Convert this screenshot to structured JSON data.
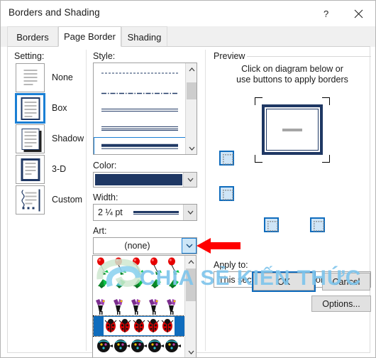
{
  "window": {
    "title": "Borders and Shading",
    "help_icon": "question-mark-icon",
    "close_icon": "close-icon"
  },
  "tabs": [
    {
      "id": "borders",
      "label": "Borders",
      "active": false
    },
    {
      "id": "page-border",
      "label": "Page Border",
      "active": true
    },
    {
      "id": "shading",
      "label": "Shading",
      "active": false
    }
  ],
  "setting": {
    "label": "Setting:",
    "options": [
      {
        "id": "none",
        "label": "None",
        "selected": false
      },
      {
        "id": "box",
        "label": "Box",
        "selected": true
      },
      {
        "id": "shadow",
        "label": "Shadow",
        "selected": false
      },
      {
        "id": "3-d",
        "label": "3-D",
        "selected": false
      },
      {
        "id": "custom",
        "label": "Custom",
        "selected": false
      }
    ]
  },
  "style": {
    "label": "Style:",
    "items": [
      {
        "id": "dashed",
        "selected": false
      },
      {
        "id": "dash-dot",
        "selected": false
      },
      {
        "id": "double-line",
        "selected": false
      },
      {
        "id": "triple-line",
        "selected": false
      },
      {
        "id": "thick-line",
        "selected": true
      }
    ],
    "scroll_up_icon": "chevron-up-icon",
    "scroll_down_icon": "chevron-down-icon"
  },
  "color": {
    "label": "Color:",
    "value_hex": "#1f3864",
    "arrow_icon": "chevron-down-icon"
  },
  "width": {
    "label": "Width:",
    "value": "2 ¼ pt",
    "arrow_icon": "chevron-down-icon"
  },
  "art": {
    "label": "Art:",
    "value": "(none)",
    "arrow_icon": "chevron-down-icon",
    "dropdown_open": true,
    "dropdown_items": [
      {
        "id": "red-balloons",
        "selected": false
      },
      {
        "id": "green-teal-leaves",
        "selected": false
      },
      {
        "id": "purple-butterflies",
        "selected": false
      },
      {
        "id": "red-ladybugs",
        "selected": true
      },
      {
        "id": "dark-beetles",
        "selected": false
      }
    ]
  },
  "preview": {
    "label": "Preview",
    "instruction_line1": "Click on diagram below or",
    "instruction_line2": "use buttons to apply borders",
    "border_buttons": [
      {
        "id": "top",
        "name": "top-border-toggle",
        "active": true
      },
      {
        "id": "bottom",
        "name": "bottom-border-toggle",
        "active": true
      },
      {
        "id": "left",
        "name": "left-border-toggle",
        "active": true
      },
      {
        "id": "right",
        "name": "right-border-toggle",
        "active": true
      }
    ]
  },
  "apply_to": {
    "label": "Apply to:",
    "value": "This section - First page only",
    "arrow_icon": "chevron-down-icon"
  },
  "buttons": {
    "options": "Options...",
    "ok": "OK",
    "cancel": "Cancel"
  },
  "annotation": {
    "arrow_color": "#ff0000",
    "arrow_direction": "left",
    "points_at": "art-dropdown-arrow"
  },
  "watermark": {
    "text": "CHIA SẺ KIẾN THỨC",
    "color": "#7fc5ec"
  }
}
